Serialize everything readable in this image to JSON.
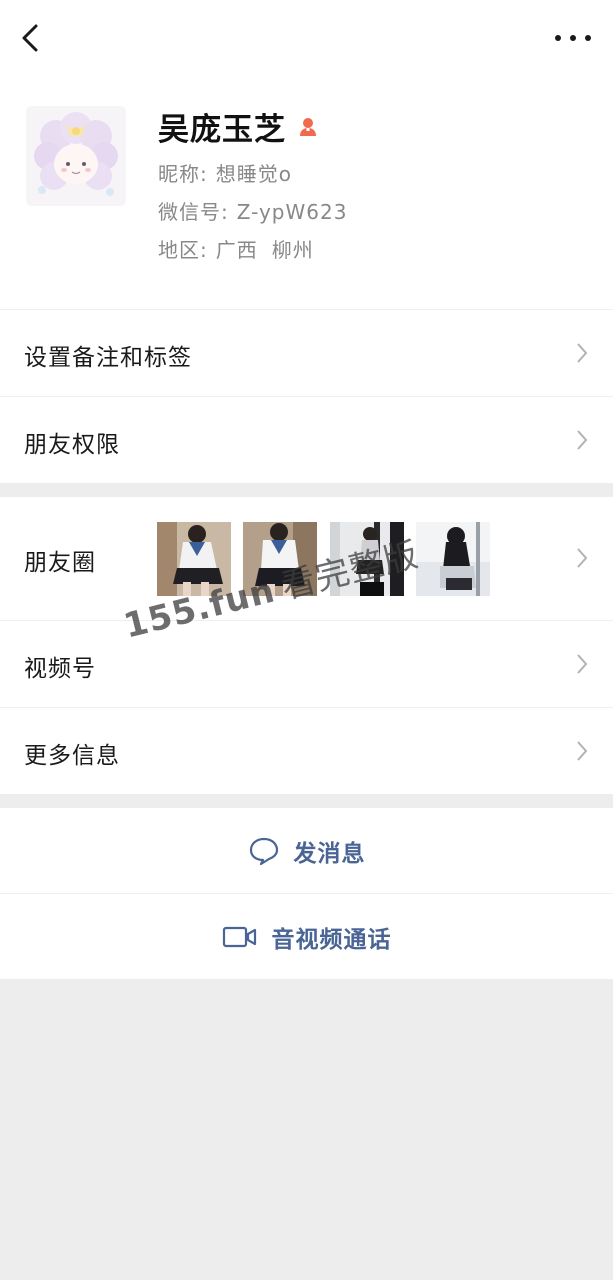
{
  "header": {
    "back_icon": "chevron-left-icon",
    "more_icon": "more-dots-icon"
  },
  "profile": {
    "name": "吴庞玉芝",
    "gender_icon": "female-person-icon",
    "nickname_label": "昵称:",
    "nickname": "想睡觉o",
    "wechat_id_label": "微信号:",
    "wechat_id": "Z-ypW623",
    "region_label": "地区:",
    "region_province": "广西",
    "region_city": "柳州"
  },
  "settings": {
    "remark_tags": "设置备注和标签",
    "friend_permissions": "朋友权限"
  },
  "features": {
    "moments": "朋友圈",
    "channels": "视频号",
    "more_info": "更多信息"
  },
  "actions": {
    "send_message": "发消息",
    "video_call": "音视频通话"
  },
  "watermark": {
    "domain": "155.fun",
    "text": "看完整版"
  },
  "colors": {
    "link_blue": "#4a6595",
    "gender_orange": "#f16a4d",
    "background": "#ededed"
  }
}
